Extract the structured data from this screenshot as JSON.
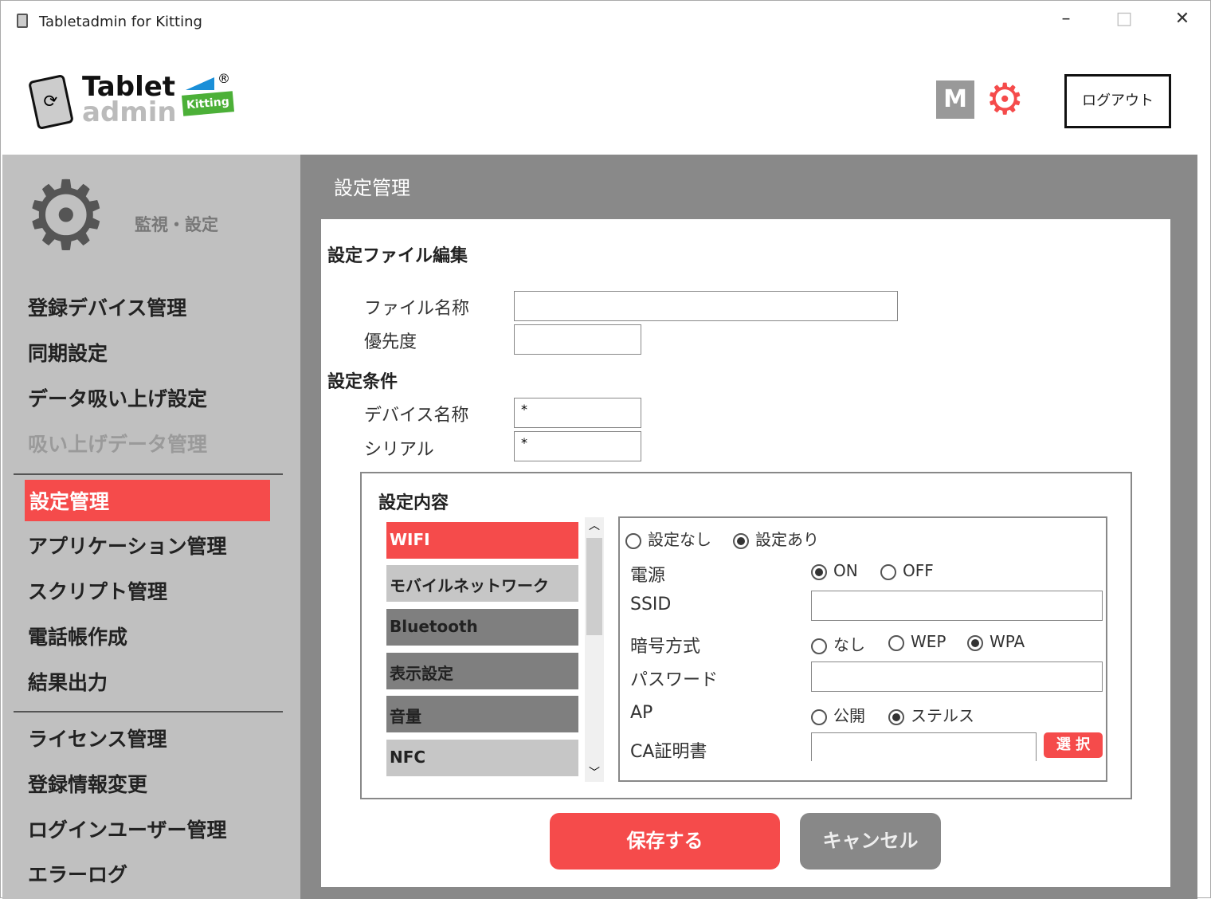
{
  "window": {
    "title": "Tabletadmin for Kitting",
    "minimize": "–",
    "maximize": "□",
    "close": "✕"
  },
  "logo": {
    "line1": "Tablet",
    "line2": "admin",
    "badge": "Kitting",
    "reg": "®"
  },
  "header": {
    "m_label": "M",
    "logout": "ログアウト",
    "accent": "#f54b4b"
  },
  "sidebar": {
    "section": "監視・設定",
    "items": [
      {
        "label": "登録デバイス管理"
      },
      {
        "label": "同期設定"
      },
      {
        "label": "データ吸い上げ設定"
      },
      {
        "label": "吸い上げデータ管理",
        "disabled": true
      },
      {
        "label": "設定管理",
        "selected": true
      },
      {
        "label": "アプリケーション管理"
      },
      {
        "label": "スクリプト管理"
      },
      {
        "label": "電話帳作成"
      },
      {
        "label": "結果出力"
      },
      {
        "label": "ライセンス管理"
      },
      {
        "label": "登録情報変更"
      },
      {
        "label": "ログインユーザー管理"
      },
      {
        "label": "エラーログ"
      }
    ]
  },
  "main": {
    "title": "設定管理",
    "edit_heading": "設定ファイル編集",
    "file_name_label": "ファイル名称",
    "file_name_value": "",
    "priority_label": "優先度",
    "priority_value": "",
    "cond_heading": "設定条件",
    "device_label": "デバイス名称",
    "device_value": "*",
    "serial_label": "シリアル",
    "serial_value": "*",
    "content_heading": "設定内容",
    "tabs": [
      {
        "label": "WIFI",
        "state": "selected"
      },
      {
        "label": "モバイルネットワーク",
        "state": "light"
      },
      {
        "label": "Bluetooth",
        "state": "dark"
      },
      {
        "label": "表示設定",
        "state": "dark"
      },
      {
        "label": "音量",
        "state": "dark"
      },
      {
        "label": "NFC",
        "state": "light"
      }
    ],
    "wifi": {
      "none": "設定なし",
      "some": "設定あり",
      "selected": "設定あり",
      "power_label": "電源",
      "power_on": "ON",
      "power_off": "OFF",
      "power_value": "ON",
      "ssid_label": "SSID",
      "ssid_value": "",
      "enc_label": "暗号方式",
      "enc_none": "なし",
      "enc_wep": "WEP",
      "enc_wpa": "WPA",
      "enc_value": "WPA",
      "pw_label": "パスワード",
      "pw_value": "",
      "ap_label": "AP",
      "ap_public": "公開",
      "ap_stealth": "ステルス",
      "ap_value": "ステルス",
      "ca_label": "CA証明書",
      "ca_value": "",
      "select": "選 択"
    },
    "save": "保存する",
    "cancel": "キャンセル"
  }
}
